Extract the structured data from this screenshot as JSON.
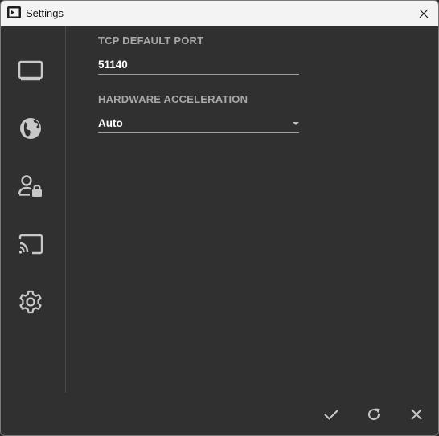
{
  "window": {
    "title": "Settings"
  },
  "sidebar": {
    "items": [
      {
        "icon": "monitor-icon"
      },
      {
        "icon": "globe-icon"
      },
      {
        "icon": "user-lock-icon"
      },
      {
        "icon": "cast-icon"
      },
      {
        "icon": "gear-icon"
      }
    ]
  },
  "settings": {
    "tcp_port": {
      "label": "TCP DEFAULT PORT",
      "value": "51140"
    },
    "hardware_acceleration": {
      "label": "HARDWARE ACCELERATION",
      "value": "Auto"
    }
  },
  "footer": {
    "confirm_icon": "checkmark-icon",
    "reset_icon": "refresh-icon",
    "cancel_icon": "close-icon"
  },
  "colors": {
    "background": "#303030",
    "icon": "#c8c8c8",
    "label": "#a8a8a8",
    "text": "#ffffff"
  }
}
